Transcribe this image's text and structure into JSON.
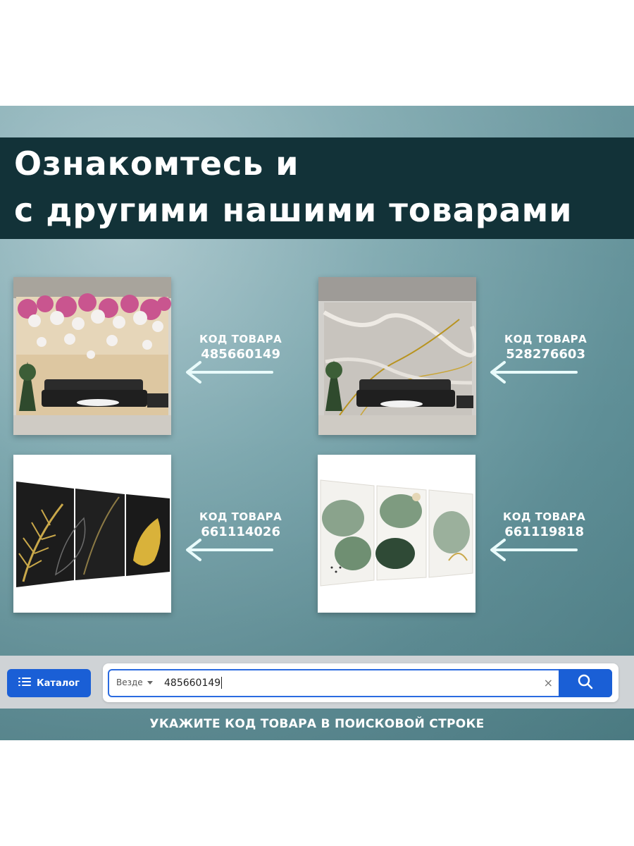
{
  "banner": {
    "line1": "Ознакомтесь и",
    "line2": "с другими нашими товарами"
  },
  "products": [
    {
      "code_label": "КОД ТОВАРА",
      "code": "485660149",
      "image": "orchid-wall-mural-living-room"
    },
    {
      "code_label": "КОД ТОВАРА",
      "code": "528276603",
      "image": "marble-wall-mural-living-room"
    },
    {
      "code_label": "КОД ТОВАРА",
      "code": "661114026",
      "image": "black-gold-leaves-triptych"
    },
    {
      "code_label": "КОД ТОВАРА",
      "code": "661119818",
      "image": "green-monstera-triptych"
    }
  ],
  "icons": {
    "arrow": "arrow-left-icon",
    "catalog": "menu-list-icon",
    "scope": "chevron-down-icon",
    "clear": "close-icon",
    "search": "search-icon"
  },
  "search": {
    "catalog_label": "Каталог",
    "scope_label": "Везде",
    "query": "485660149",
    "clear_symbol": "×"
  },
  "footer": {
    "hint": "УКАЖИТЕ КОД ТОВАРА В ПОИСКОВОЙ СТРОКЕ"
  },
  "colors": {
    "banner": "#123238",
    "accent": "#1a5fd6",
    "arrow": "#e9fbfb",
    "panel": "#6f9ca3"
  }
}
